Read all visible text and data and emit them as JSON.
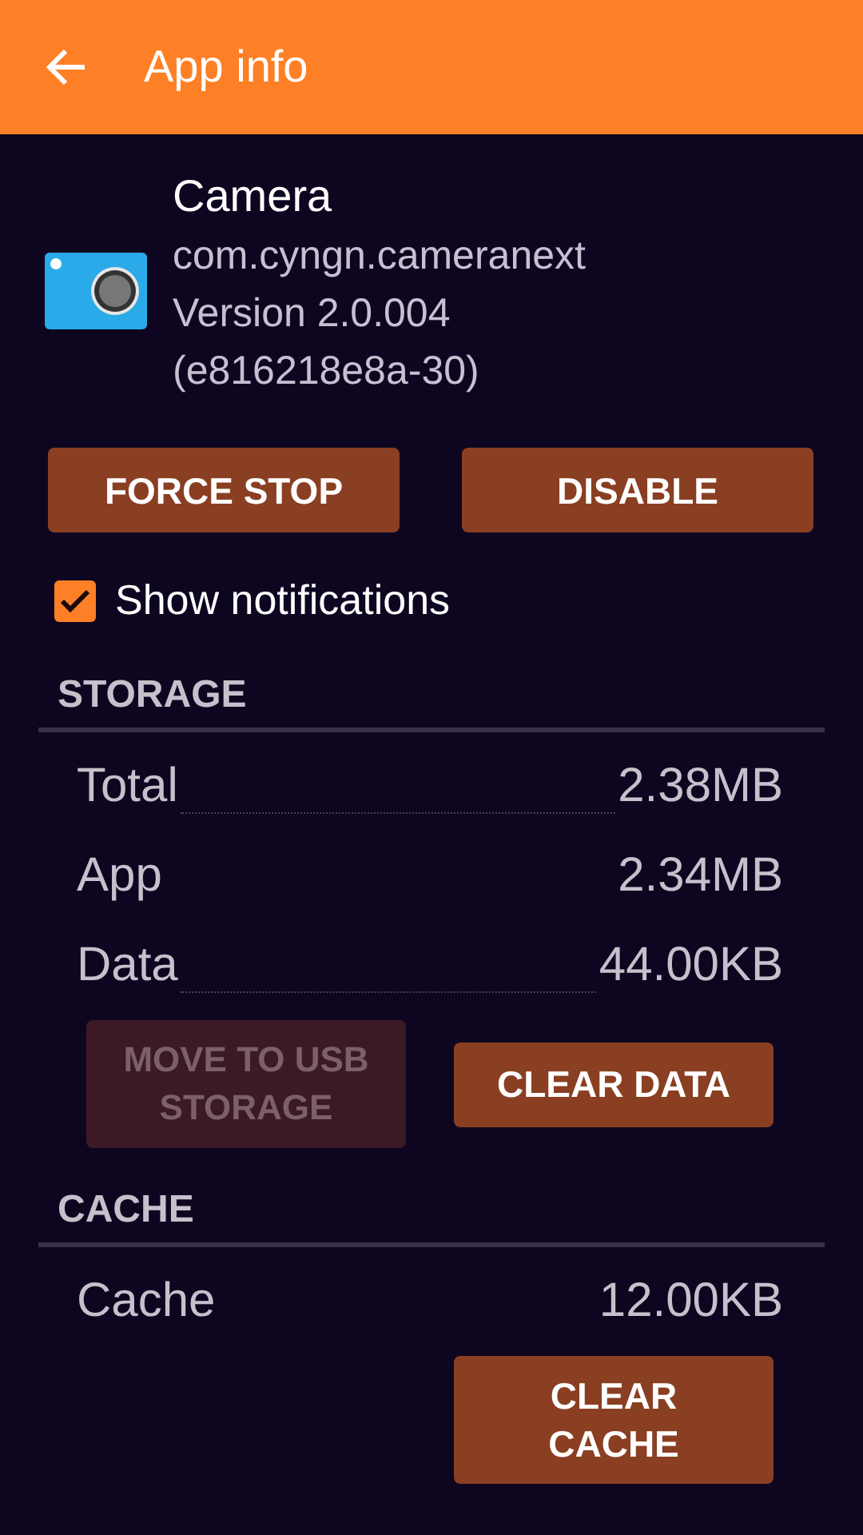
{
  "app_bar": {
    "title": "App info"
  },
  "app": {
    "name": "Camera",
    "package": "com.cyngn.cameranext",
    "version": "Version 2.0.004",
    "build": "(e816218e8a-30)"
  },
  "actions": [
    {
      "label": "FORCE STOP",
      "disabled": false
    },
    {
      "label": "DISABLE",
      "disabled": false
    }
  ],
  "show_notifications": {
    "label": "Show notifications",
    "checked": true
  },
  "sections": [
    {
      "heading": "STORAGE",
      "rows": [
        {
          "label": "Total",
          "value": "2.38MB",
          "leader": true
        },
        {
          "label": "App",
          "value": "2.34MB",
          "leader": false
        },
        {
          "label": "Data",
          "value": "44.00KB",
          "leader": true
        }
      ],
      "buttons": [
        {
          "label": "MOVE TO USB STORAGE",
          "disabled": true
        },
        {
          "label": "CLEAR DATA",
          "disabled": false
        }
      ]
    },
    {
      "heading": "CACHE",
      "rows": [
        {
          "label": "Cache",
          "value": "12.00KB",
          "leader": false
        }
      ],
      "buttons": [
        {
          "label": "CLEAR CACHE",
          "disabled": false
        }
      ]
    }
  ]
}
